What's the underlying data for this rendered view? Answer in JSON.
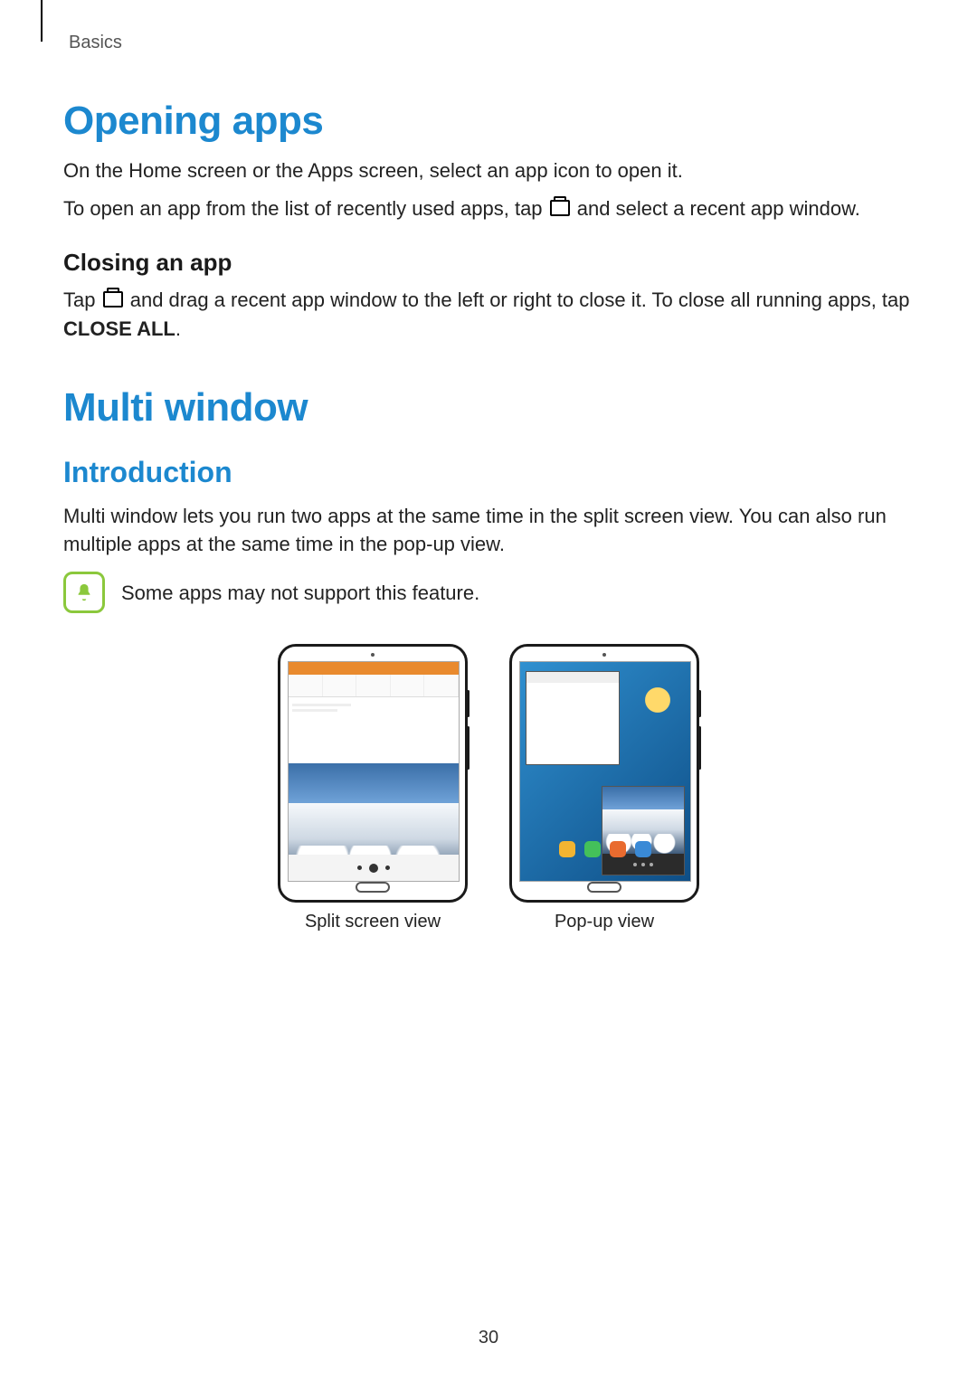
{
  "header": {
    "breadcrumb": "Basics"
  },
  "opening": {
    "title": "Opening apps",
    "p1a": "On the Home screen or the Apps screen, select an app icon to open it.",
    "p2a": "To open an app from the list of recently used apps, tap ",
    "p2b": " and select a recent app window."
  },
  "closing": {
    "title": "Closing an app",
    "p1a": "Tap ",
    "p1b": " and drag a recent app window to the left or right to close it. To close all running apps, tap ",
    "p1c": "CLOSE ALL",
    "p1d": "."
  },
  "multiwindow": {
    "title": "Multi window",
    "intro_title": "Introduction",
    "intro_body": "Multi window lets you run two apps at the same time in the split screen view. You can also run multiple apps at the same time in the pop-up view.",
    "note": "Some apps may not support this feature.",
    "fig1_caption": "Split screen view",
    "fig2_caption": "Pop-up view"
  },
  "footer": {
    "page_number": "30"
  }
}
